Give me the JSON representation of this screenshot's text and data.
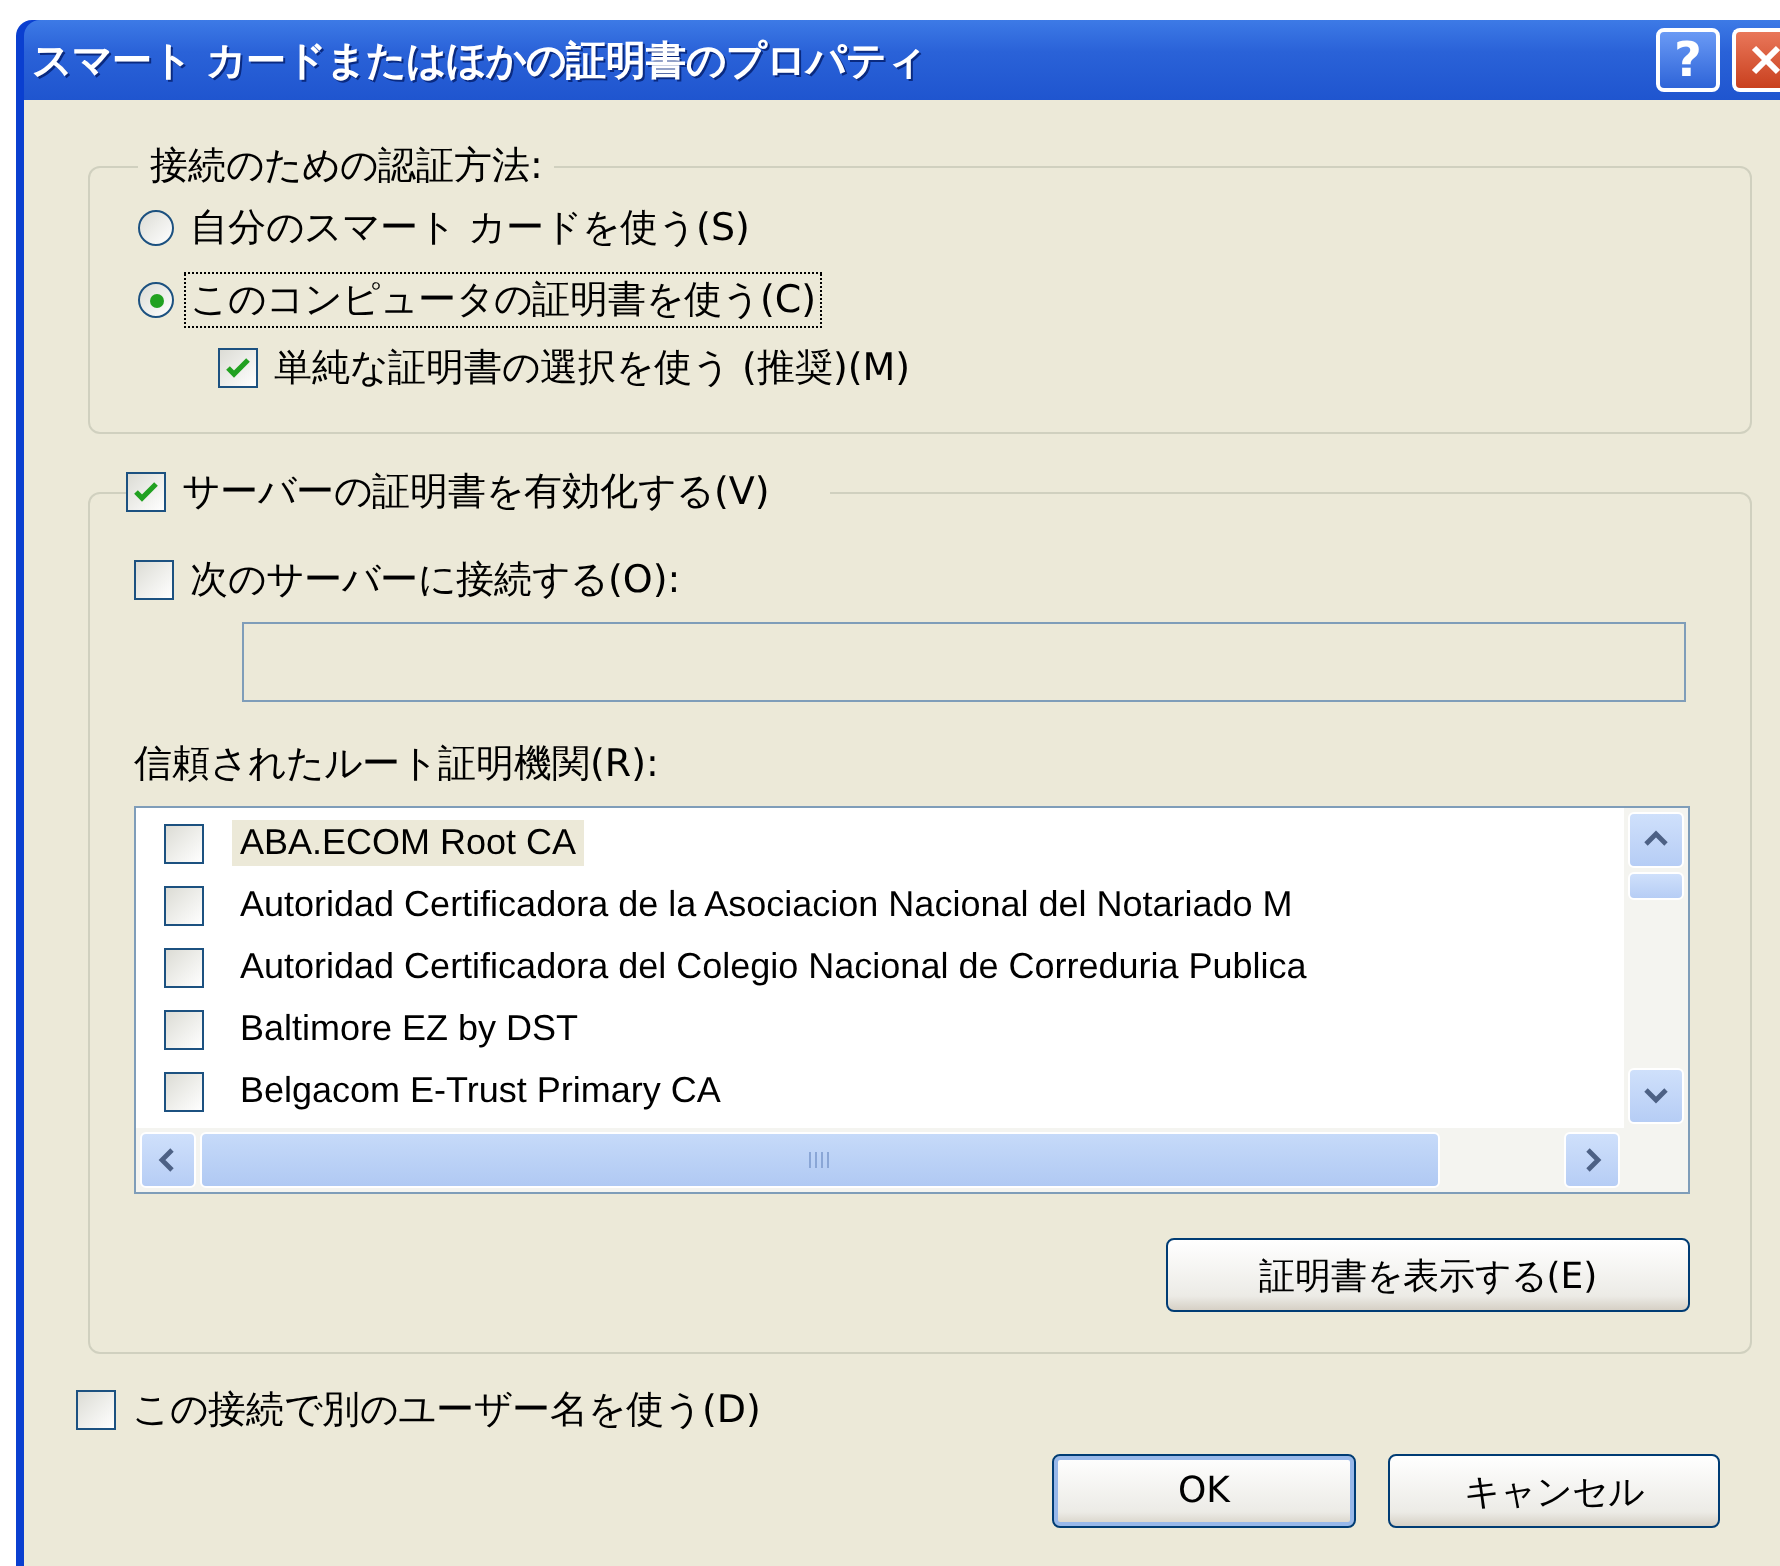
{
  "window": {
    "title": "スマート カードまたはほかの証明書のプロパティ",
    "help": "?"
  },
  "auth_group": {
    "legend": "接続のための認証方法:",
    "options": [
      {
        "label": "自分のスマート カードを使う(S)",
        "selected": false
      },
      {
        "label": "このコンピュータの証明書を使う(C)",
        "selected": true
      }
    ],
    "simple_selection": {
      "label": "単純な証明書の選択を使う (推奨)(M)",
      "checked": true
    }
  },
  "server_group": {
    "validate": {
      "label": "サーバーの証明書を有効化する(V)",
      "checked": true
    },
    "connect": {
      "label": "次のサーバーに接続する(O):",
      "checked": false
    },
    "roots_label": "信頼されたルート証明機関(R):",
    "roots": [
      {
        "label": "ABA.ECOM Root CA",
        "checked": false,
        "selected": true
      },
      {
        "label": "Autoridad Certificadora de la Asociacion Nacional del Notariado M",
        "checked": false,
        "selected": false
      },
      {
        "label": "Autoridad Certificadora del Colegio Nacional de Correduria Publica",
        "checked": false,
        "selected": false
      },
      {
        "label": "Baltimore EZ by DST",
        "checked": false,
        "selected": false
      },
      {
        "label": "Belgacom E-Trust Primary CA",
        "checked": false,
        "selected": false
      }
    ],
    "view_button": "証明書を表示する(E)"
  },
  "other_user": {
    "label": "この接続で別のユーザー名を使う(D)",
    "checked": false
  },
  "buttons": [
    "OK",
    "キャンセル"
  ]
}
